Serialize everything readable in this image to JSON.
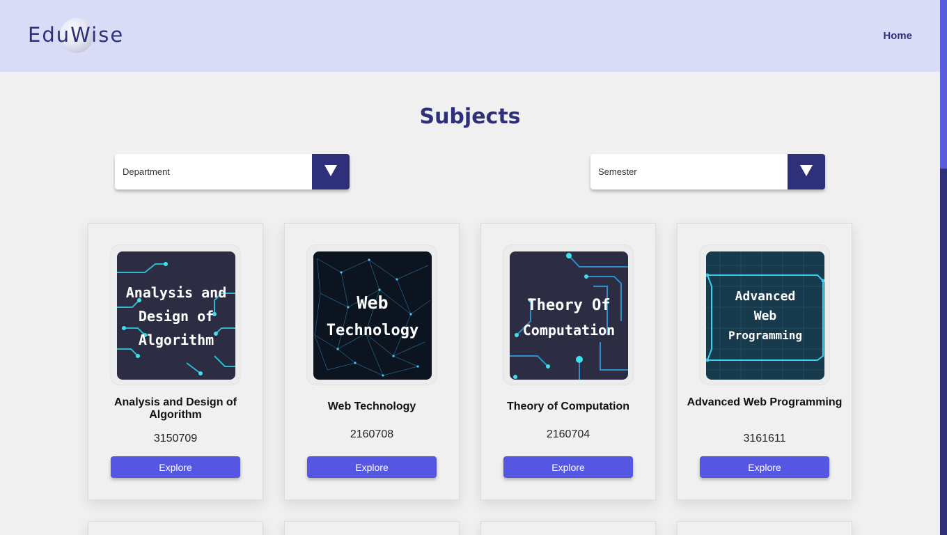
{
  "brand": {
    "name": "EduWise"
  },
  "nav": {
    "home": "Home"
  },
  "page": {
    "title": "Subjects"
  },
  "filters": {
    "department": "Department",
    "semester": "Semester"
  },
  "colors": {
    "primary": "#2e3079",
    "accent": "#5557e3",
    "nav_bg": "#d8dcf7"
  },
  "subjects": [
    {
      "title": "Analysis and Design of Algorithm",
      "code": "3150709",
      "cover_lines": [
        "Analysis and",
        "Design of",
        "Algorithm"
      ],
      "button": "Explore"
    },
    {
      "title": "Web Technology",
      "code": "2160708",
      "cover_lines": [
        "Web",
        "Technology"
      ],
      "button": "Explore"
    },
    {
      "title": "Theory of Computation",
      "code": "2160704",
      "cover_lines": [
        "Theory Of",
        "Computation"
      ],
      "button": "Explore"
    },
    {
      "title": "Advanced Web Programming",
      "code": "3161611",
      "cover_lines": [
        "Advanced",
        "Web",
        "Programming"
      ],
      "button": "Explore"
    }
  ]
}
